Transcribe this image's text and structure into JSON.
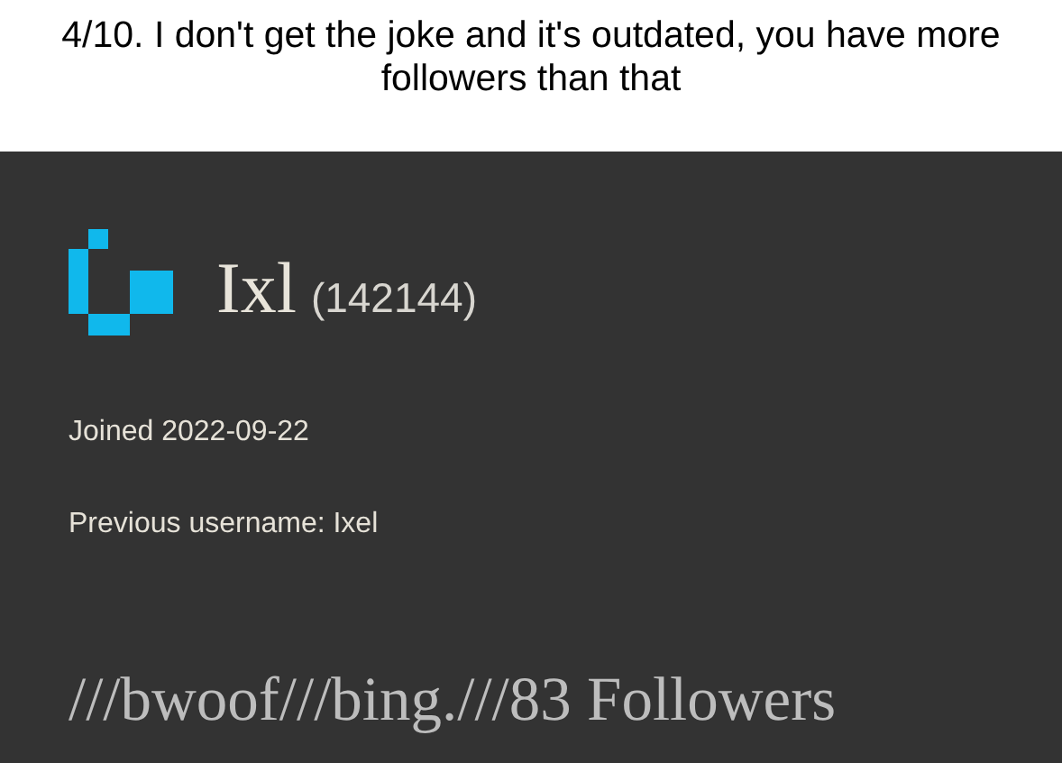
{
  "caption": "4/10. I don't get the joke and it's outdated, you have more followers than that",
  "profile": {
    "username": "Ixl",
    "user_id": "(142144)",
    "joined": "Joined 2022-09-22",
    "previous_username": "Previous username: Ixel",
    "status": "///bwoof///bing.///83 Followers"
  }
}
